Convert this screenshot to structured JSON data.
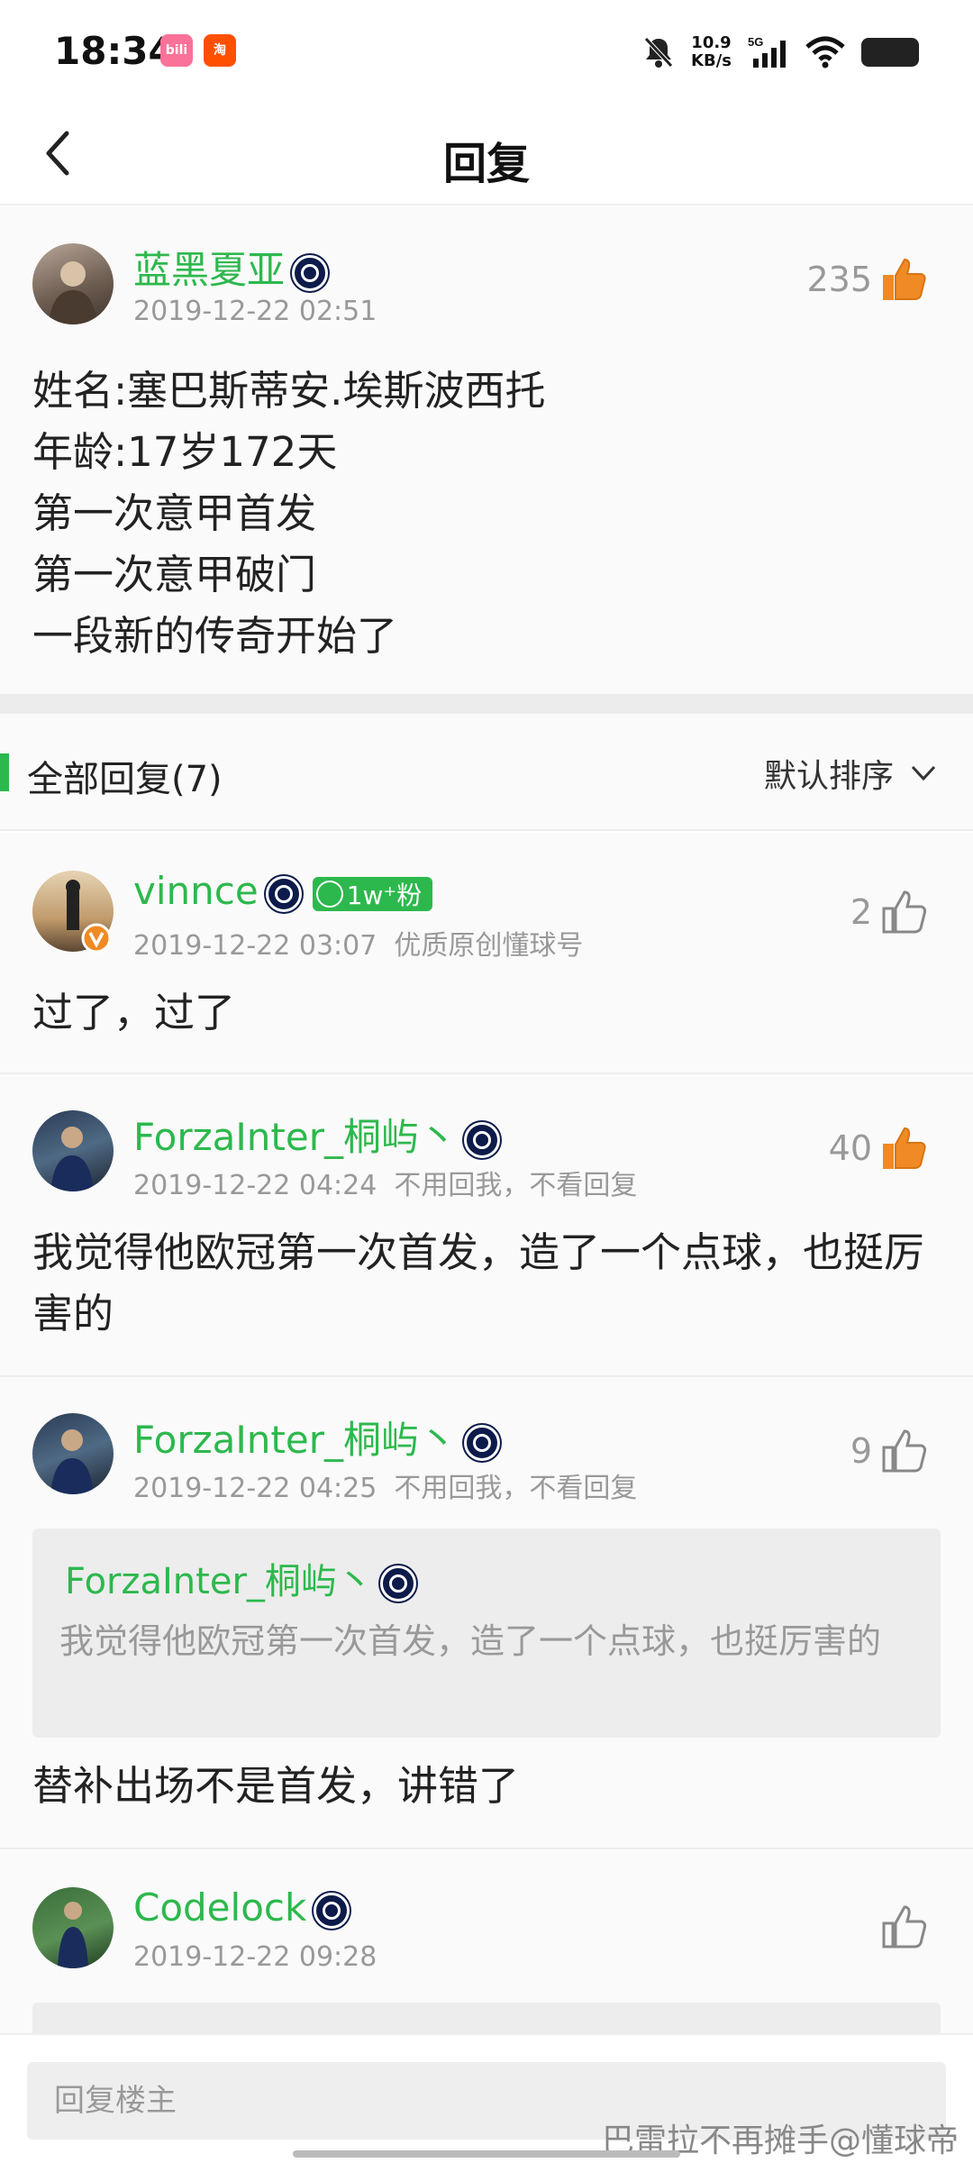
{
  "status_bar": {
    "time": "18:34",
    "app_badges": [
      "bilibili",
      "淘"
    ],
    "net_speed_top": "10.9",
    "net_speed_bottom": "KB/s",
    "network": "5G"
  },
  "header": {
    "title": "回复"
  },
  "main_comment": {
    "username": "蓝黑夏亚",
    "timestamp": "2019-12-22 02:51",
    "likes": "235",
    "lines": [
      "姓名:塞巴斯蒂安.埃斯波西托",
      "年龄:17岁172天",
      "第一次意甲首发",
      "第一次意甲破门",
      "一段新的传奇开始了"
    ]
  },
  "replies_header": {
    "title": "全部回复(7)",
    "sort_label": "默认排序"
  },
  "replies": [
    {
      "username": "vinnce",
      "fans_badge": "1w⁺粉",
      "timestamp": "2019-12-22 03:07",
      "tag": "优质原创懂球号",
      "likes": "2",
      "text": "过了，过了"
    },
    {
      "username": "ForzaInter_桐屿丶",
      "timestamp": "2019-12-22 04:24",
      "tag": "不用回我，不看回复",
      "likes": "40",
      "text": "我觉得他欧冠第一次首发，造了一个点球，也挺厉害的"
    },
    {
      "username": "ForzaInter_桐屿丶",
      "timestamp": "2019-12-22 04:25",
      "tag": "不用回我，不看回复",
      "likes": "9",
      "quote_user": "ForzaInter_桐屿丶",
      "quote_text": "我觉得他欧冠第一次首发，造了一个点球，也挺厉害的",
      "text": "替补出场不是首发，讲错了"
    },
    {
      "username": "Codelock",
      "timestamp": "2019-12-22 09:28",
      "likes": ""
    }
  ],
  "bottom": {
    "placeholder": "回复楼主",
    "watermark": "巴雷拉不再摊手@懂球帝"
  },
  "colors": {
    "accent_green": "#2db84d",
    "like_orange": "#f08a24",
    "text_gray": "#999999"
  }
}
